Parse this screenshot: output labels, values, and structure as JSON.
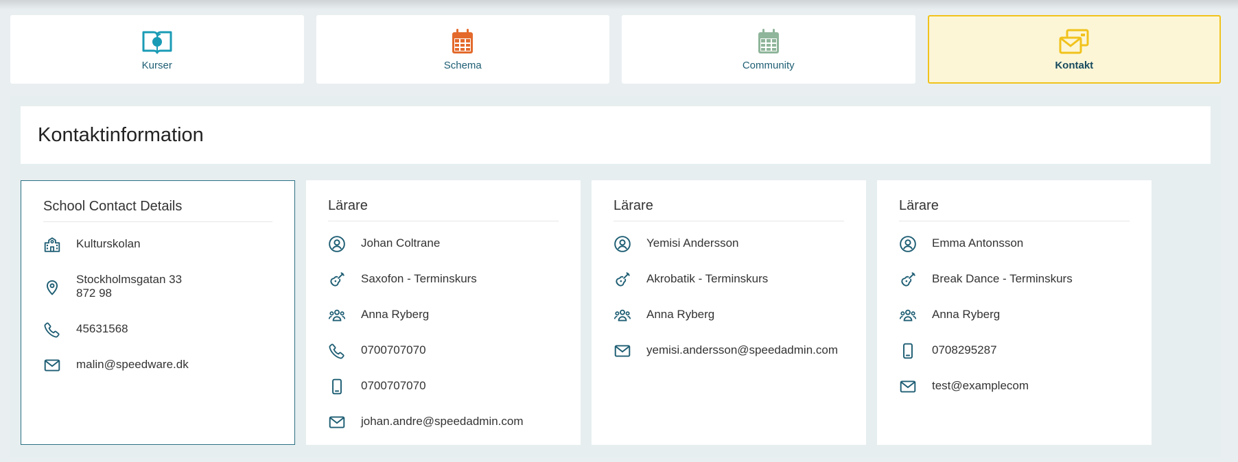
{
  "tabs": [
    {
      "label": "Kurser",
      "icon": "book-apple-icon",
      "color": "#1a9bb5"
    },
    {
      "label": "Schema",
      "icon": "calendar-icon",
      "color": "#e36a2c"
    },
    {
      "label": "Community",
      "icon": "calendar-grid-icon",
      "color": "#8fb59a"
    },
    {
      "label": "Kontakt",
      "icon": "envelopes-icon",
      "color": "#f1c21b",
      "active": true
    }
  ],
  "page": {
    "title": "Kontaktinformation"
  },
  "school": {
    "title": "School Contact Details",
    "name": "Kulturskolan",
    "address_line1": "Stockholmsgatan 33",
    "address_line2": "872 98",
    "phone": "45631568",
    "email": "malin@speedware.dk"
  },
  "teachers": [
    {
      "title": "Lärare",
      "name": "Johan Coltrane",
      "course": "Saxofon - Terminskurs",
      "group": "Anna Ryberg",
      "phone": "0700707070",
      "mobile": "0700707070",
      "email": "johan.andre@speedadmin.com"
    },
    {
      "title": "Lärare",
      "name": "Yemisi Andersson",
      "course": "Akrobatik - Terminskurs",
      "group": "Anna Ryberg",
      "email": "yemisi.andersson@speedadmin.com"
    },
    {
      "title": "Lärare",
      "name": "Emma Antonsson",
      "course": "Break Dance - Terminskurs",
      "group": "Anna Ryberg",
      "mobile": "0708295287",
      "email": "test@examplecom"
    }
  ],
  "colors": {
    "icon": "#1d5d73",
    "accent": "#f1c21b",
    "school_border": "#2b6f83"
  }
}
